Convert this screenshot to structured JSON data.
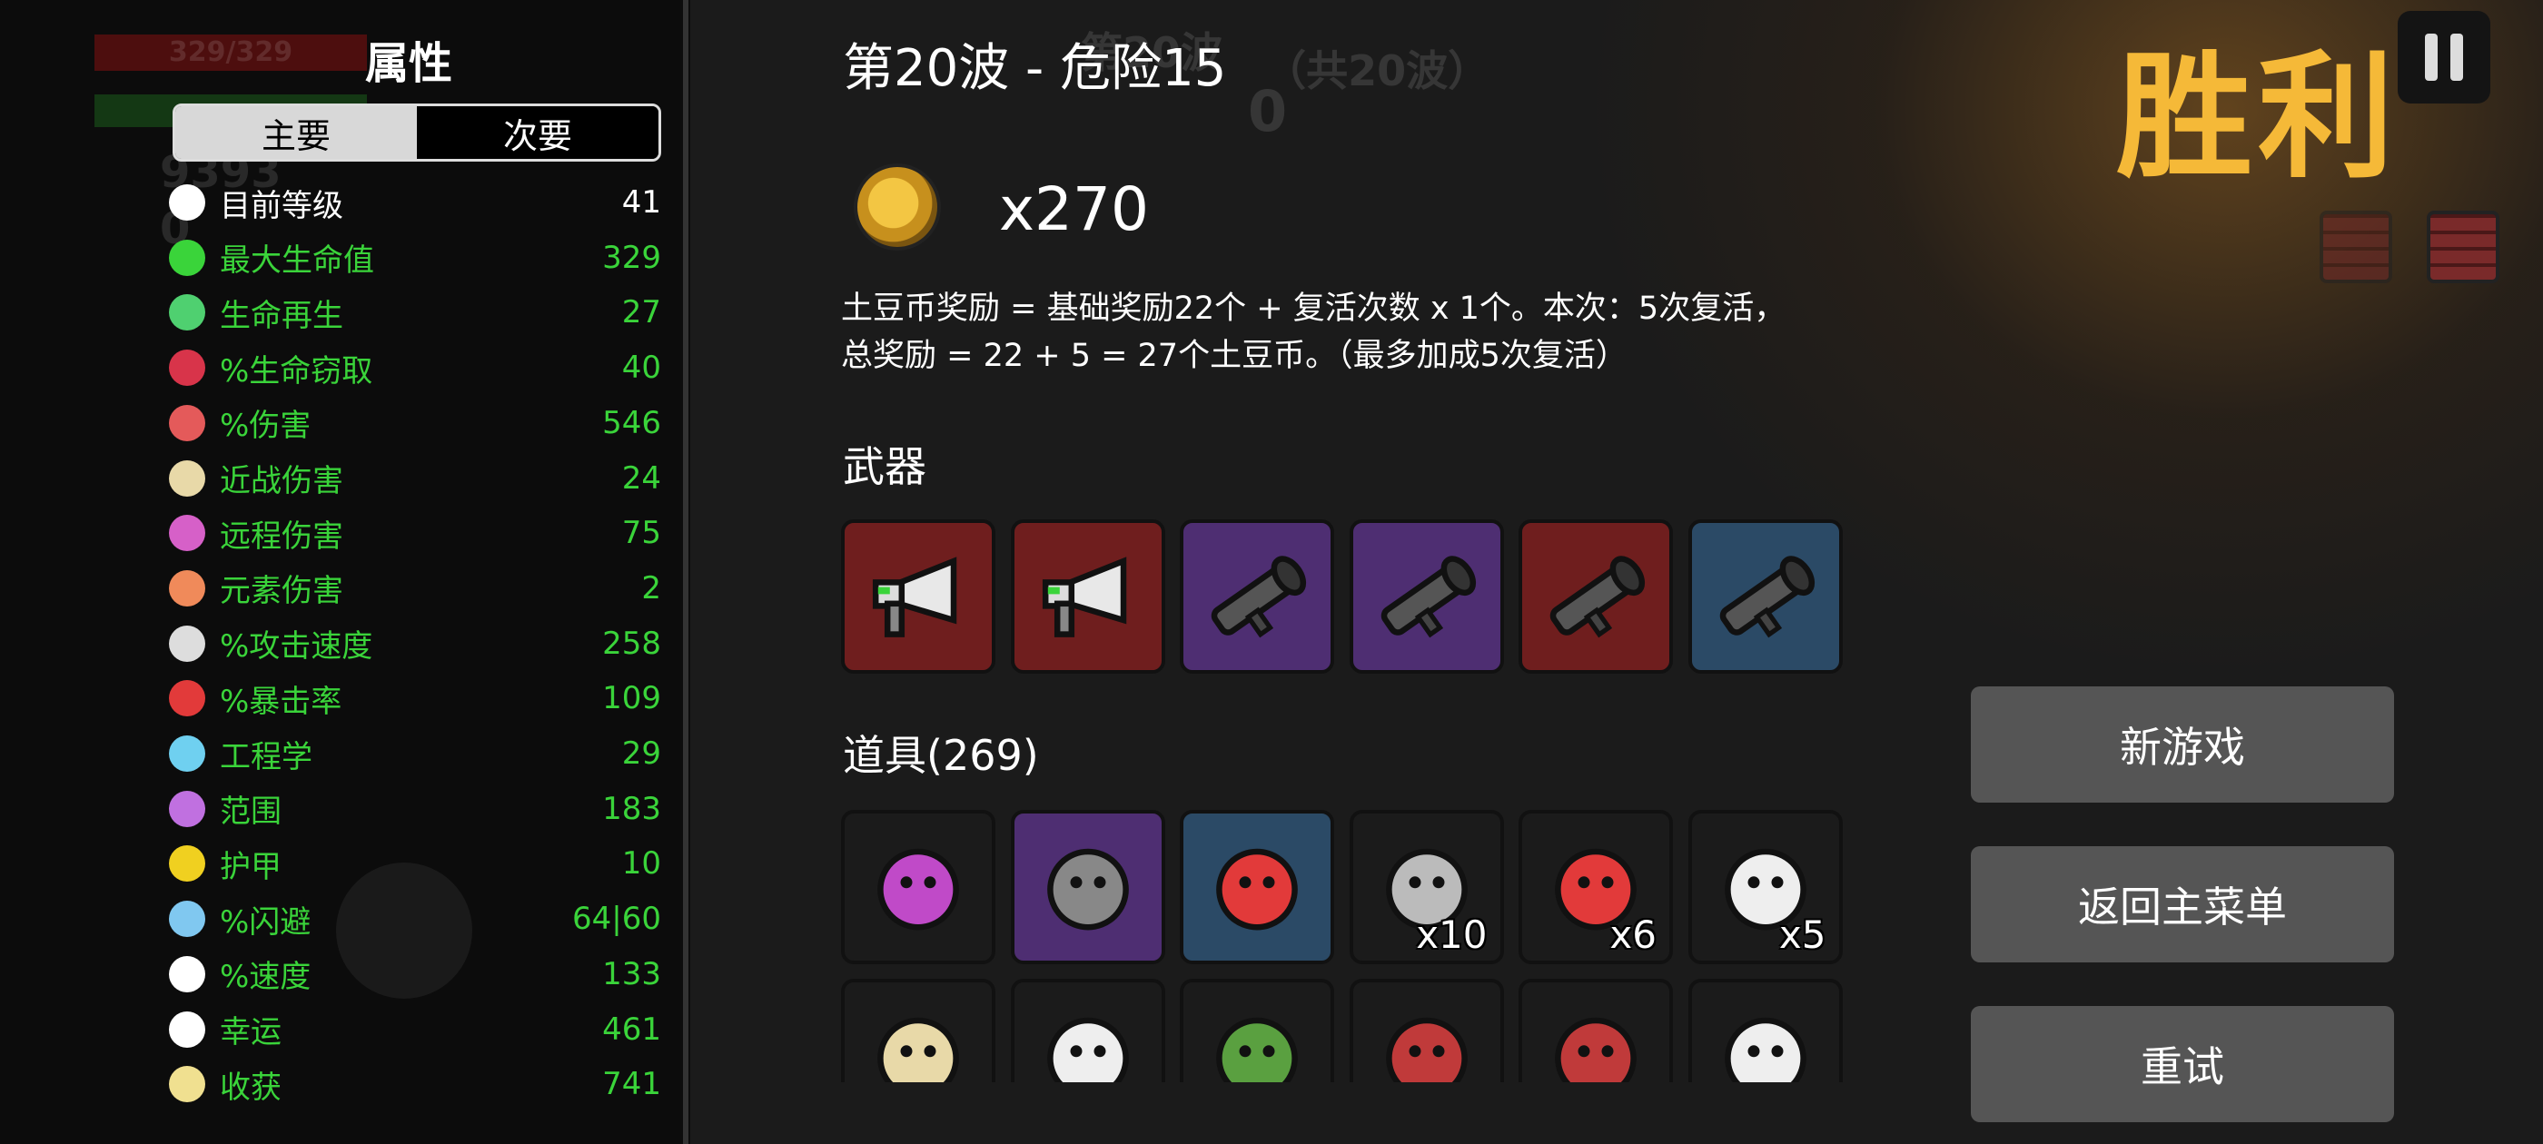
{
  "background": {
    "hp_bar_ghost": "329/329",
    "materials_ghost": "9393",
    "bag_ghost": "0",
    "wave_ghost": "第20波",
    "timer_ghost": "0"
  },
  "stats": {
    "title": "属性",
    "tabs": [
      "主要",
      "次要"
    ],
    "active_tab": "主要",
    "rows": [
      {
        "label": "目前等级",
        "value": "41",
        "color": "white",
        "icon": "level-icon",
        "icon_color": "#ffffff"
      },
      {
        "label": "最大生命值",
        "value": "329",
        "color": "green",
        "icon": "heart-icon",
        "icon_color": "#3ad43a"
      },
      {
        "label": "生命再生",
        "value": "27",
        "color": "green",
        "icon": "regen-icon",
        "icon_color": "#4fd070"
      },
      {
        "label": "%生命窃取",
        "value": "40",
        "color": "green",
        "icon": "lifesteal-icon",
        "icon_color": "#d8344a"
      },
      {
        "label": "%伤害",
        "value": "546",
        "color": "green",
        "icon": "damage-icon",
        "icon_color": "#e45a5a"
      },
      {
        "label": "近战伤害",
        "value": "24",
        "color": "green",
        "icon": "melee-icon",
        "icon_color": "#e8d9a8"
      },
      {
        "label": "远程伤害",
        "value": "75",
        "color": "green",
        "icon": "ranged-icon",
        "icon_color": "#d660c8"
      },
      {
        "label": "元素伤害",
        "value": "2",
        "color": "green",
        "icon": "elemental-icon",
        "icon_color": "#f08a5a"
      },
      {
        "label": "%攻击速度",
        "value": "258",
        "color": "green",
        "icon": "attack-speed-icon",
        "icon_color": "#dddddd"
      },
      {
        "label": "%暴击率",
        "value": "109",
        "color": "green",
        "icon": "crit-icon",
        "icon_color": "#e23a3a"
      },
      {
        "label": "工程学",
        "value": "29",
        "color": "green",
        "icon": "engineering-icon",
        "icon_color": "#6fd0f0"
      },
      {
        "label": "范围",
        "value": "183",
        "color": "green",
        "icon": "range-icon",
        "icon_color": "#c070e0"
      },
      {
        "label": "护甲",
        "value": "10",
        "color": "green",
        "icon": "armor-icon",
        "icon_color": "#f0d020"
      },
      {
        "label": "%闪避",
        "value": "64|60",
        "color": "green",
        "icon": "dodge-icon",
        "icon_color": "#80c8f0"
      },
      {
        "label": "%速度",
        "value": "133",
        "color": "green",
        "icon": "speed-icon",
        "icon_color": "#ffffff"
      },
      {
        "label": "幸运",
        "value": "461",
        "color": "green",
        "icon": "luck-icon",
        "icon_color": "#ffffff"
      },
      {
        "label": "收获",
        "value": "741",
        "color": "green",
        "icon": "harvest-icon",
        "icon_color": "#f0e090"
      }
    ]
  },
  "summary": {
    "wave_title": "第20波 - 危险15",
    "wave_total_ghost": "（共20波）",
    "coin_icon": "potato-coin-icon",
    "coin_count": "x270",
    "reward_line1": "土豆币奖励 = 基础奖励22个 + 复活次数 x 1个。本次：5次复活，",
    "reward_line2": "总奖励 = 22 + 5 = 27个土豆币。（最多加成5次复活）",
    "weapons_title": "武器",
    "weapons": [
      {
        "name": "megaphone-weapon",
        "tier": "red"
      },
      {
        "name": "megaphone-weapon",
        "tier": "red"
      },
      {
        "name": "rocket-launcher-weapon",
        "tier": "purple"
      },
      {
        "name": "rocket-launcher-weapon",
        "tier": "purple"
      },
      {
        "name": "rocket-launcher-weapon",
        "tier": "red"
      },
      {
        "name": "rocket-launcher-weapon",
        "tier": "blue"
      }
    ],
    "items_title": "道具(269)",
    "items_row1": [
      {
        "name": "statue-item",
        "tier": "dark",
        "qty": ""
      },
      {
        "name": "spiky-shield-item",
        "tier": "purple",
        "qty": ""
      },
      {
        "name": "clown-face-item",
        "tier": "blue",
        "qty": ""
      },
      {
        "name": "scythe-potion-item",
        "tier": "dark",
        "qty": "x10"
      },
      {
        "name": "syringe-item",
        "tier": "dark",
        "qty": "x6"
      },
      {
        "name": "bandaged-potato-item",
        "tier": "dark",
        "qty": "x5"
      }
    ],
    "items_row2": [
      {
        "name": "treasure-map-item",
        "tier": "dark"
      },
      {
        "name": "lizard-item",
        "tier": "dark"
      },
      {
        "name": "tree-item",
        "tier": "dark"
      },
      {
        "name": "flannel-shirt-item",
        "tier": "dark"
      },
      {
        "name": "dynamite-item",
        "tier": "dark"
      },
      {
        "name": "coffee-cup-item",
        "tier": "dark"
      }
    ]
  },
  "right": {
    "victory": "胜利",
    "buttons": [
      "新游戏",
      "返回主菜单",
      "重试"
    ]
  },
  "colors": {
    "accent_gold": "#f5b938",
    "stat_green": "#3ad43a",
    "button_gray": "#555555",
    "tier_red": "#6f1e1e",
    "tier_purple": "#4e2e72",
    "tier_blue": "#2b4a66"
  }
}
